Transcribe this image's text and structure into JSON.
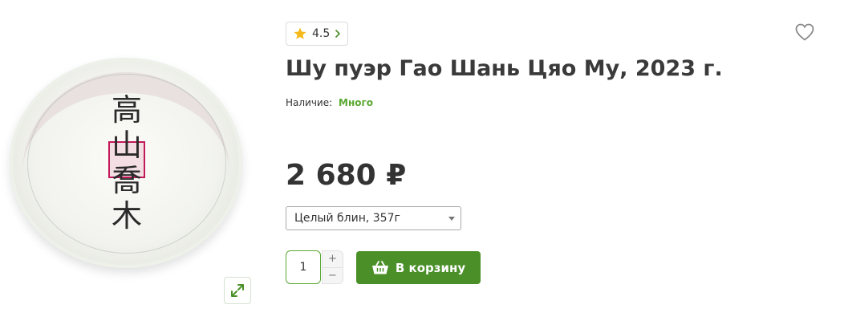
{
  "product": {
    "title": "Шу пуэр Гао Шань Цяо Му, 2023 г.",
    "rating": "4.5",
    "availability_label": "Наличие:",
    "availability_value": "Много",
    "price": "2 680 ₽",
    "variant_selected": "Целый блин, 357г",
    "quantity": "1",
    "qty_plus": "+",
    "qty_minus": "−",
    "add_to_cart_label": "В корзину",
    "image_chars": [
      "高",
      "山",
      "喬",
      "木"
    ]
  },
  "colors": {
    "accent_green": "#4a8f28",
    "availability_green": "#5aa832",
    "star_yellow": "#f6b91a",
    "stamp_red": "#c2195a"
  },
  "icons": {
    "rating": "star-icon",
    "rating_arrow": "chevron-right-icon",
    "favorite": "heart-icon",
    "expand": "expand-icon",
    "cart": "basket-icon",
    "select": "caret-down-icon"
  }
}
